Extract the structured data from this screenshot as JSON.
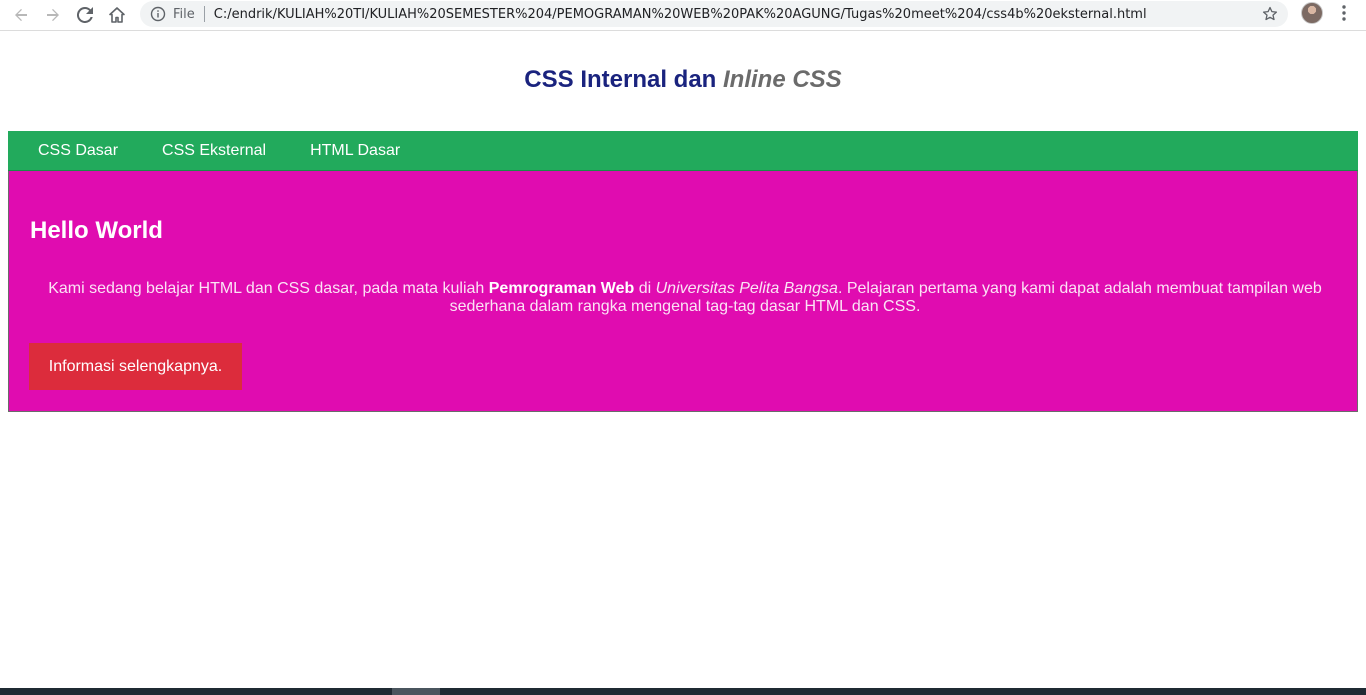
{
  "browser": {
    "scheme_label": "File",
    "url": "C:/endrik/KULIAH%20TI/KULIAH%20SEMESTER%204/PEMOGRAMAN%20WEB%20PAK%20AGUNG/Tugas%20meet%204/css4b%20eksternal.html"
  },
  "page": {
    "title_plain": "CSS Internal dan ",
    "title_emphasis": "Inline CSS",
    "nav": [
      "CSS Dasar",
      "CSS Eksternal",
      "HTML Dasar"
    ],
    "heading": "Hello World",
    "para_1": "Kami sedang belajar HTML dan CSS dasar, pada mata kuliah ",
    "para_bold": "Pemrograman Web",
    "para_2": " di ",
    "para_italic": "Universitas Pelita Bangsa",
    "para_3": ". Pelajaran pertama yang kami dapat adalah membuat tampilan web sederhana dalam rangka mengenal tag-tag dasar HTML dan CSS.",
    "button_label": "Informasi selengkapnya."
  },
  "colors": {
    "title": "#1a237e",
    "navbar": "#22aa5c",
    "panel": "#e00cb0",
    "button": "#dc2c3c"
  }
}
